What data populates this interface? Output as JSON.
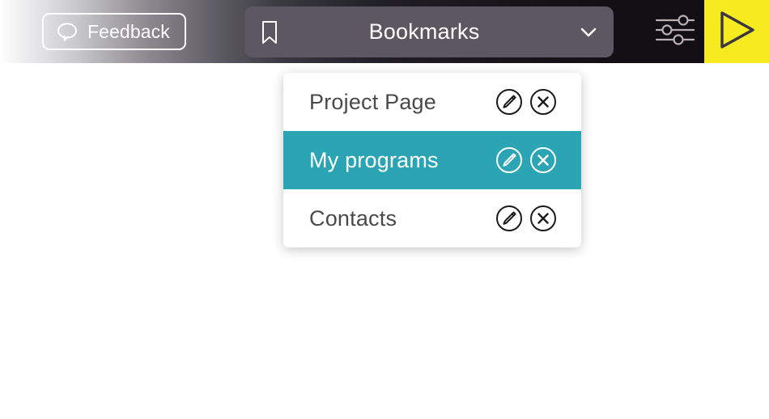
{
  "theme": {
    "accent_yellow": "#F5EB1E",
    "selected_teal": "#2BA5B4",
    "toolbar_dark": "#110F14",
    "select_bg": "#5D5762",
    "text_dark": "#4A4A4A"
  },
  "toolbar": {
    "feedback_label": "Feedback",
    "feedback_icon": "speech-bubble-icon",
    "sliders_icon": "sliders-settings-icon",
    "play_icon": "play-triangle-icon"
  },
  "bookmarks_select": {
    "label": "Bookmarks",
    "leading_icon": "bookmark-ribbon-icon",
    "trailing_icon": "chevron-down-icon",
    "expanded": true
  },
  "dropdown": {
    "items": [
      {
        "label": "Project Page",
        "selected": false,
        "edit_icon": "pencil-circle-icon",
        "delete_icon": "close-circle-icon"
      },
      {
        "label": "My programs",
        "selected": true,
        "edit_icon": "pencil-circle-icon",
        "delete_icon": "close-circle-icon"
      },
      {
        "label": "Contacts",
        "selected": false,
        "edit_icon": "pencil-circle-icon",
        "delete_icon": "close-circle-icon"
      }
    ]
  }
}
